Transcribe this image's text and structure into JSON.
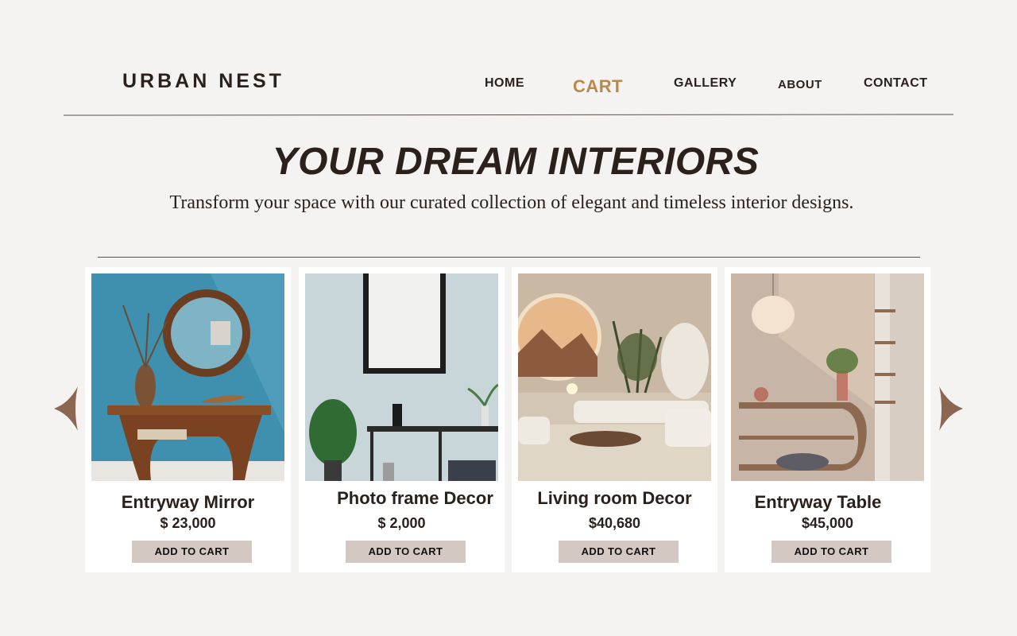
{
  "brand": {
    "name": "URBAN NEST"
  },
  "nav": {
    "home": "HOME",
    "cart": "CART",
    "gallery": "GALLERY",
    "about": "ABOUT",
    "contact": "CONTACT"
  },
  "hero": {
    "title": "YOUR DREAM INTERIORS",
    "subtitle": "Transform your space with our curated collection of elegant and timeless interior designs."
  },
  "products": [
    {
      "name": "Entryway Mirror",
      "price": "$ 23,000",
      "button": "ADD TO CART"
    },
    {
      "name": "Photo frame Decor",
      "price": "$ 2,000",
      "button": "ADD TO CART"
    },
    {
      "name": "Living room Decor",
      "price": "$40,680",
      "button": "ADD TO CART"
    },
    {
      "name": "Entryway Table",
      "price": "$45,000",
      "button": "ADD TO CART"
    }
  ],
  "carousel": {
    "prev_icon": "chevron-left-icon",
    "next_icon": "chevron-right-icon"
  },
  "colors": {
    "background": "#f4f3f1",
    "text": "#2b211c",
    "accent_cart": "#b9894a",
    "button": "#d3c9c2",
    "arrow": "#8b6650"
  }
}
